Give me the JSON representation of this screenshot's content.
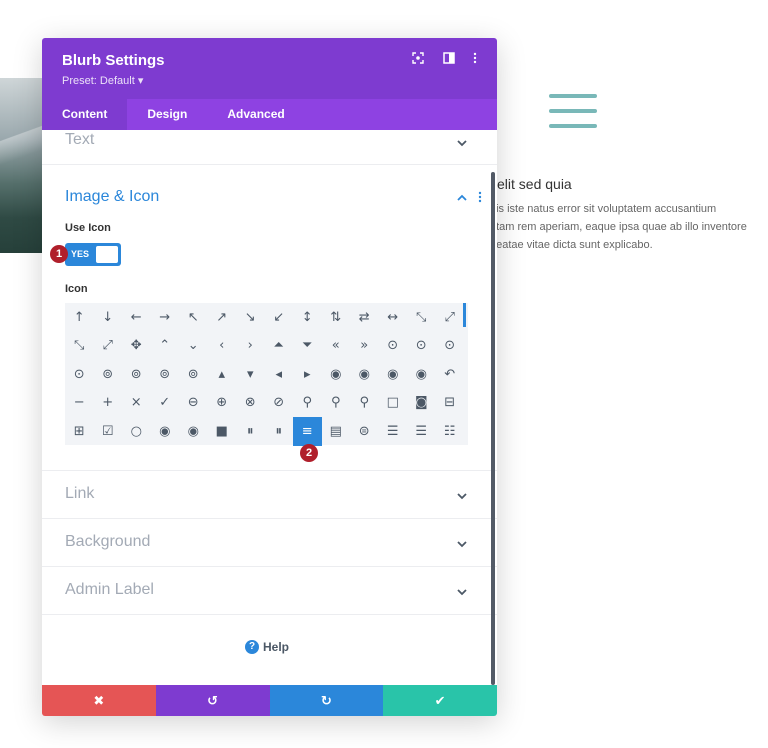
{
  "background": {
    "title": "velit sed quia",
    "lines": [
      "nis iste natus error sit voluptatem accusantium",
      "ptam rem aperiam, eaque ipsa quae ab illo inventore",
      "beatae vitae dicta sunt explicabo."
    ]
  },
  "modal": {
    "title": "Blurb Settings",
    "preset": "Preset: Default ▾",
    "header_icons": [
      "screenshot-icon",
      "sidebar-icon",
      "more-vertical-icon"
    ],
    "tabs": [
      {
        "label": "Content",
        "active": true
      },
      {
        "label": "Design",
        "active": false
      },
      {
        "label": "Advanced",
        "active": false
      }
    ]
  },
  "sections": {
    "text": {
      "title": "Text"
    },
    "image_icon": {
      "title": "Image & Icon",
      "use_icon_label": "Use Icon",
      "toggle_value": "YES",
      "icon_label": "Icon"
    },
    "link": {
      "title": "Link"
    },
    "background": {
      "title": "Background"
    },
    "admin_label": {
      "title": "Admin Label"
    }
  },
  "icons": [
    "↑",
    "↓",
    "←",
    "→",
    "↖",
    "↗",
    "↘",
    "↙",
    "↕",
    "⇅",
    "⇄",
    "↔",
    "⤡",
    "⤢",
    "⤡",
    "⤢",
    "✥",
    "⌃",
    "⌄",
    "‹",
    "›",
    "⏶",
    "⏷",
    "«",
    "»",
    "⊙",
    "⊙",
    "⊙",
    "⊙",
    "⊚",
    "⊚",
    "⊚",
    "⊚",
    "▴",
    "▾",
    "◂",
    "▸",
    "◉",
    "◉",
    "◉",
    "◉",
    "↶",
    "−",
    "+",
    "×",
    "✓",
    "⊖",
    "⊕",
    "⊗",
    "⊘",
    "⚲",
    "⚲",
    "⚲",
    "□",
    "◙",
    "⊟",
    "⊞",
    "☑",
    "○",
    "◉",
    "◉",
    "■",
    "⏸",
    "⏸",
    "≡",
    "▤",
    "⊜",
    "☰",
    "☰",
    "☷"
  ],
  "selected_icon_index": 64,
  "markers": {
    "one": "1",
    "two": "2"
  },
  "help": {
    "label": "Help"
  },
  "footer": {
    "cancel": "✖",
    "undo": "↺",
    "redo": "↻",
    "save": "✔"
  },
  "colors": {
    "header": "#7e3bd0",
    "tabs": "#8e42e2",
    "accent": "#2b87da",
    "cancel": "#e55555",
    "undo": "#7e3bd0",
    "redo": "#2b87da",
    "save": "#29c4a9"
  }
}
